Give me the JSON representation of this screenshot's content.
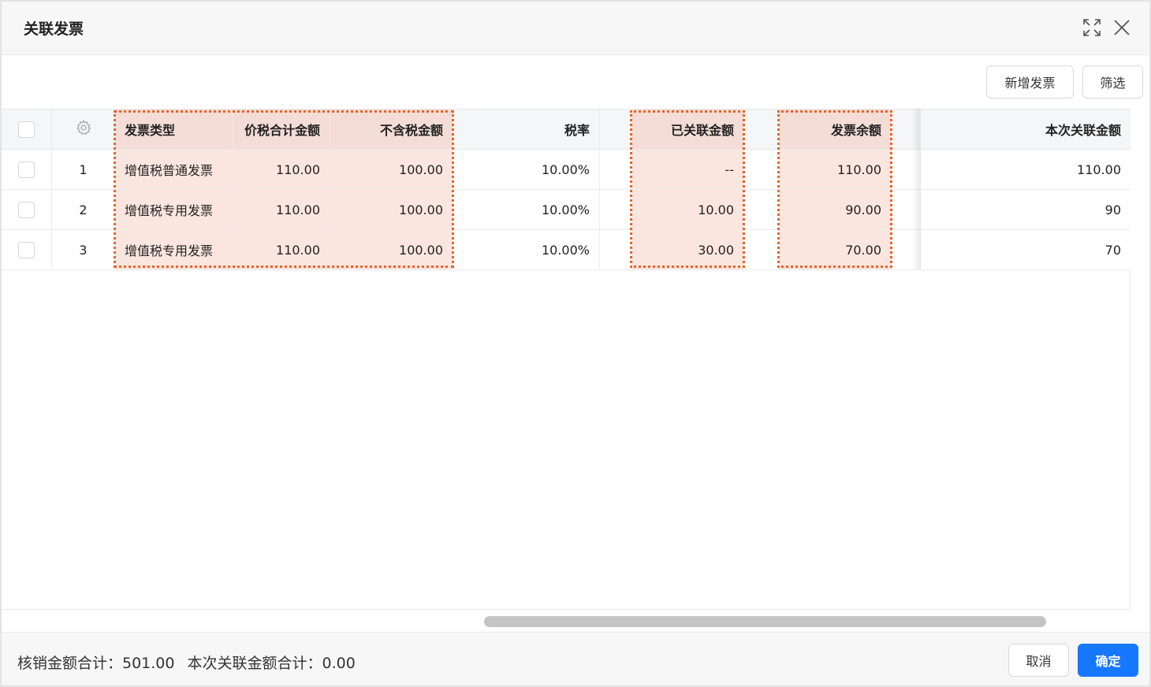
{
  "dialog": {
    "title": "关联发票",
    "expand_icon": "expand-icon",
    "close_icon": "close-icon"
  },
  "toolbar": {
    "add_invoice_label": "新增发票",
    "filter_label": "筛选"
  },
  "table": {
    "settings_icon": "gear-icon",
    "columns": [
      "发票类型",
      "价税合计金额",
      "不含税金额",
      "税率",
      "已关联金额",
      "发票余额",
      "本次关联金额"
    ],
    "rows": [
      {
        "index": "1",
        "type": "增值税普通发票",
        "total": "110.00",
        "untaxed": "100.00",
        "rate": "10.00%",
        "linked": "--",
        "balance": "110.00",
        "current": "110.00"
      },
      {
        "index": "2",
        "type": "增值税专用发票",
        "total": "110.00",
        "untaxed": "100.00",
        "rate": "10.00%",
        "linked": "10.00",
        "balance": "90.00",
        "current": "90"
      },
      {
        "index": "3",
        "type": "增值税专用发票",
        "total": "110.00",
        "untaxed": "100.00",
        "rate": "10.00%",
        "linked": "30.00",
        "balance": "70.00",
        "current": "70"
      }
    ]
  },
  "footer": {
    "writeoff_total": "核销金额合计：501.00",
    "current_total": "本次关联金额合计：0.00",
    "cancel_label": "取消",
    "confirm_label": "确定"
  },
  "colors": {
    "accent": "#1677ff",
    "link": "#2a6ce0",
    "highlight": "#fbe6df",
    "highlight_border": "#e8632a"
  }
}
